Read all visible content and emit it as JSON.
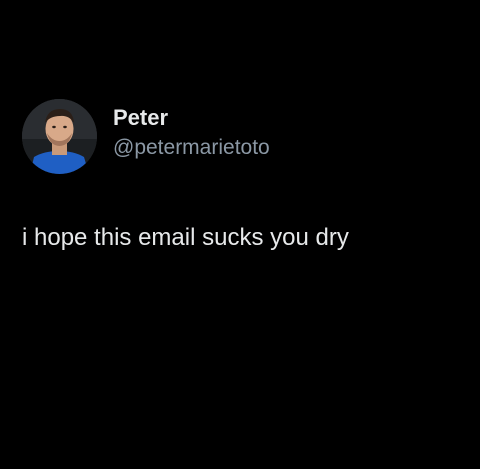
{
  "colors": {
    "background": "#000000",
    "name_text": "#e7e9ea",
    "handle_text": "#8b98a5",
    "body_text": "#e7e9ea"
  },
  "author": {
    "display_name": "Peter",
    "handle": "@petermarietoto",
    "avatar_icon": "user-avatar-photo"
  },
  "tweet": {
    "text": "i hope this email sucks you dry"
  }
}
